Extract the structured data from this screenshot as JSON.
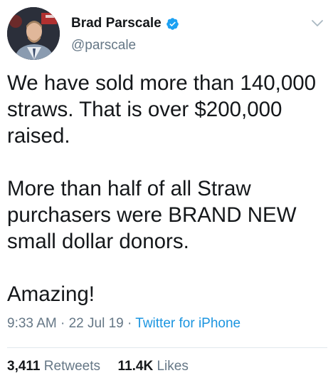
{
  "tweet": {
    "author": {
      "display_name": "Brad Parscale",
      "handle": "@parscale",
      "verified": true,
      "avatar_icon": "profile-photo",
      "verified_color": "#1da1f2"
    },
    "menu_icon": "chevron-down-icon",
    "paragraphs": [
      [
        "We have sold more than 140,000",
        "straws. That is over $200,000",
        "raised."
      ],
      [
        "More than half of all Straw",
        "purchasers were BRAND NEW",
        "small dollar donors."
      ],
      [
        "Amazing!"
      ]
    ],
    "time": "9:33 AM",
    "date": "22 Jul 19",
    "separator": "·",
    "source": "Twitter for iPhone",
    "retweets_count": "3,411",
    "retweets_label": "Retweets",
    "likes_count": "11.4K",
    "likes_label": "Likes"
  },
  "colors": {
    "text": "#14171a",
    "muted": "#657786",
    "link": "#1b95e0",
    "divider": "#e1e8ed"
  }
}
